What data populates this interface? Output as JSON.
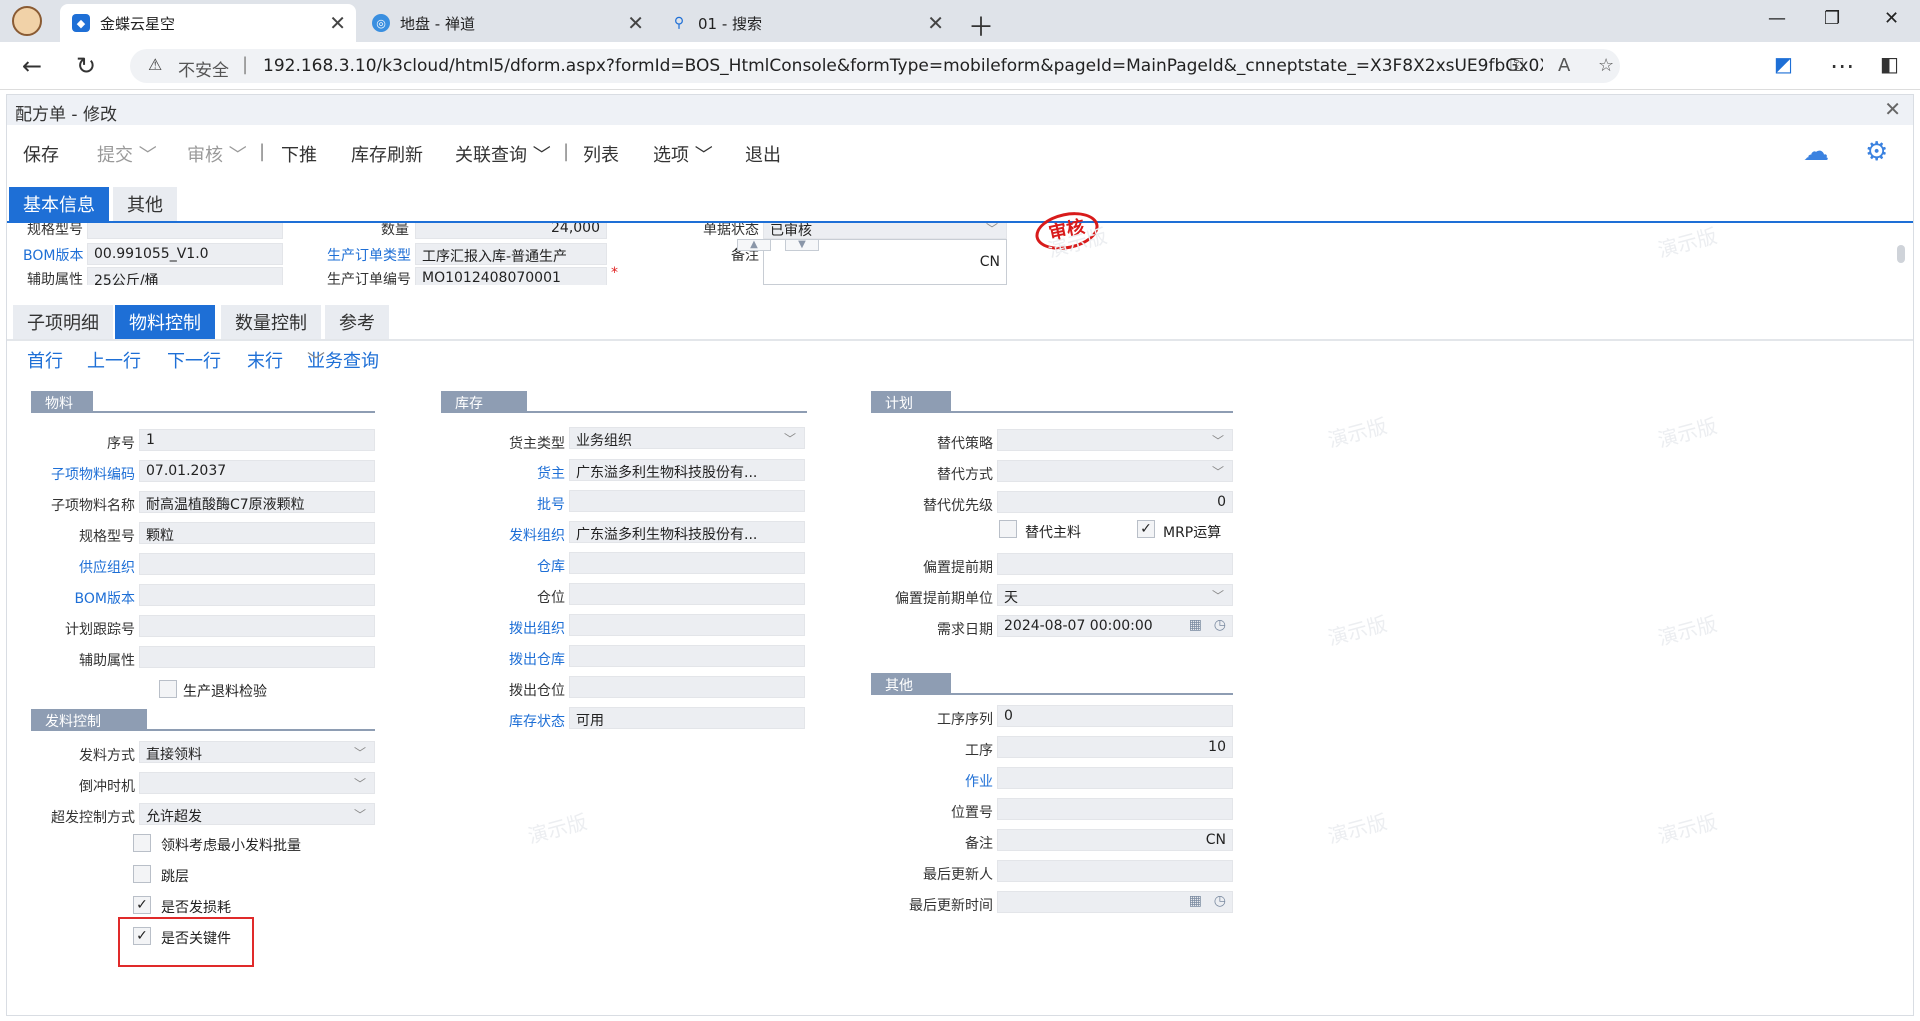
{
  "browser": {
    "tabs": [
      {
        "label": "金蝶云星空",
        "active": true
      },
      {
        "label": "地盘 - 禅道",
        "active": false
      },
      {
        "label": "01 - 搜索",
        "active": false
      }
    ],
    "address": {
      "not_secure": "不安全",
      "url": "192.168.3.10/k3cloud/html5/dform.aspx?formId=BOS_HtmlConsole&formType=mobileform&pageId=MainPageId&_cnneptstate_=X3F8X2xsUE9fbGx0X2xscnJvPW88cjxncz..."
    }
  },
  "app": {
    "title": "配方单 - 修改",
    "toolbar": {
      "save": "保存",
      "submit": "提交",
      "audit": "审核",
      "push_down": "下推",
      "stock_refresh": "库存刷新",
      "related_query": "关联查询",
      "list": "列表",
      "options": "选项",
      "exit": "退出"
    },
    "main_tabs": [
      "基本信息",
      "其他"
    ],
    "header": {
      "spec_label": "规格型号",
      "qty_label": "数量",
      "qty_value": "24,000",
      "doc_status_label": "单据状态",
      "doc_status_value": "已审核",
      "bom_label": "BOM版本",
      "bom_value": "00.991055_V1.0",
      "mo_type_label": "生产订单类型",
      "mo_type_value": "工序汇报入库-普通生产",
      "remark_label": "备注",
      "remark_lang": "CN",
      "aux_label": "辅助属性",
      "aux_value": "25公斤/桶",
      "mo_no_label": "生产订单编号",
      "mo_no_value": "MO1012408070001",
      "stamp": "审核",
      "watermark": "演示版"
    },
    "detail_tabs": [
      "子项明细",
      "物料控制",
      "数量控制",
      "参考"
    ],
    "row_nav": {
      "first": "首行",
      "prev": "上一行",
      "next": "下一行",
      "last": "末行",
      "biz_query": "业务查询"
    },
    "material": {
      "title": "物料",
      "seq_label": "序号",
      "seq_value": "1",
      "code_label": "子项物料编码",
      "code_value": "07.01.2037",
      "name_label": "子项物料名称",
      "name_value": "耐高温植酸酶C7原液颗粒",
      "spec_label": "规格型号",
      "spec_value": "颗粒",
      "supply_org_label": "供应组织",
      "bom_label": "BOM版本",
      "track_label": "计划跟踪号",
      "aux_label": "辅助属性",
      "return_check_label": "生产退料检验"
    },
    "issue_control": {
      "title": "发料控制",
      "method_label": "发料方式",
      "method_value": "直接领料",
      "backflush_label": "倒冲时机",
      "over_label": "超发控制方式",
      "over_value": "允许超发",
      "min_batch_label": "领料考虑最小发料批量",
      "skip_label": "跳层",
      "loss_label": "是否发损耗",
      "key_part_label": "是否关键件"
    },
    "stock": {
      "title": "库存",
      "owner_type_label": "货主类型",
      "owner_type_value": "业务组织",
      "owner_label": "货主",
      "owner_value": "广东溢多利生物科技股份有...",
      "lot_label": "批号",
      "issue_org_label": "发料组织",
      "issue_org_value": "广东溢多利生物科技股份有...",
      "wh_label": "仓库",
      "loc_label": "仓位",
      "out_org_label": "拨出组织",
      "out_wh_label": "拨出仓库",
      "out_loc_label": "拨出仓位",
      "status_label": "库存状态",
      "status_value": "可用"
    },
    "plan": {
      "title": "计划",
      "strategy_label": "替代策略",
      "mode_label": "替代方式",
      "priority_label": "替代优先级",
      "priority_value": "0",
      "main_label": "替代主料",
      "mrp_label": "MRP运算",
      "offset_label": "偏置提前期",
      "offset_unit_label": "偏置提前期单位",
      "offset_unit_value": "天",
      "need_date_label": "需求日期",
      "need_date_value": "2024-08-07 00:00:00"
    },
    "other": {
      "title": "其他",
      "op_seq_label": "工序序列",
      "op_seq_value": "0",
      "op_label": "工序",
      "op_value": "10",
      "job_label": "作业",
      "pos_label": "位置号",
      "remark_label": "备注",
      "remark_lang": "CN",
      "updater_label": "最后更新人",
      "update_time_label": "最后更新时间"
    }
  }
}
